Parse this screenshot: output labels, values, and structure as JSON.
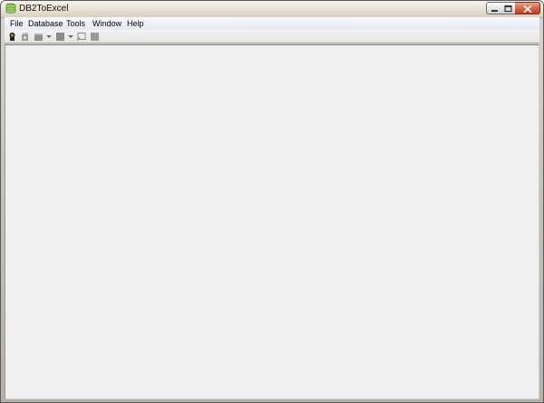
{
  "window": {
    "title": "DB2ToExcel",
    "controls": [
      "minimize-icon",
      "maximize-icon",
      "close-icon"
    ]
  },
  "menubar": {
    "items": [
      {
        "label": "File"
      },
      {
        "label": "Database"
      },
      {
        "label": "Tools"
      },
      {
        "label": "Window"
      },
      {
        "label": "Help"
      }
    ]
  },
  "toolbar": {
    "buttons": [
      "connect-icon",
      "disconnect-icon",
      "new-query-icon",
      "stop-icon",
      "run-icon",
      "export-icon"
    ]
  }
}
